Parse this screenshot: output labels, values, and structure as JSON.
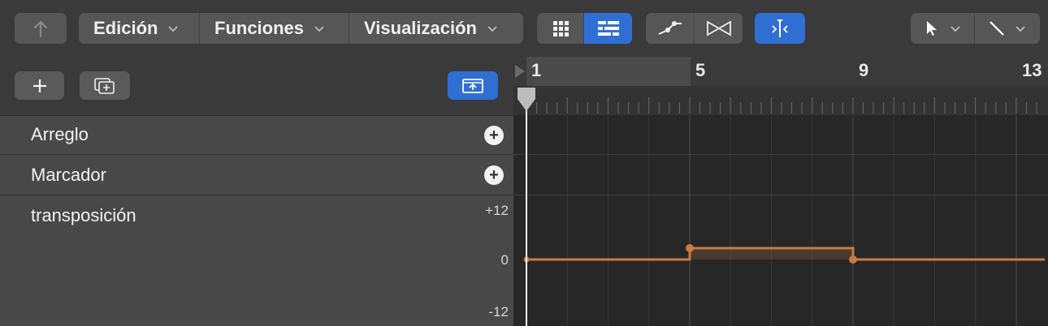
{
  "toolbar": {
    "back_icon": "back-arrow-icon",
    "menus": [
      {
        "label": "Edición"
      },
      {
        "label": "Funciones"
      },
      {
        "label": "Visualización"
      }
    ],
    "view_buttons": [
      "grid-view-icon",
      "list-view-icon"
    ],
    "curve_buttons": [
      "automation-curve-icon",
      "crossfade-icon"
    ],
    "snap_icon": "catch-playhead-icon",
    "tools": [
      "pointer-tool-icon",
      "pencil-tool-icon"
    ],
    "accent_color": "#2f6fd4"
  },
  "track_panel": {
    "add_button_icon": "plus-icon",
    "duplicate_button_icon": "duplicate-track-icon",
    "upload_button_icon": "move-to-top-icon",
    "lanes": [
      {
        "label": "Arreglo"
      },
      {
        "label": "Marcador"
      },
      {
        "label": "transposición"
      }
    ],
    "transpose_scale": {
      "top": "+12",
      "mid": "0",
      "bottom": "-12"
    }
  },
  "timeline": {
    "bar_numbers": [
      "1",
      "5",
      "9",
      "13"
    ],
    "transposition_curve_color": "#c97a45",
    "curve": [
      {
        "bar": 1,
        "value": 0
      },
      {
        "bar": 5,
        "value": 0
      },
      {
        "bar": 5,
        "value": 1
      },
      {
        "bar": 9,
        "value": 1
      },
      {
        "bar": 9,
        "value": 0
      },
      {
        "bar": 13.7,
        "value": 0
      }
    ]
  }
}
